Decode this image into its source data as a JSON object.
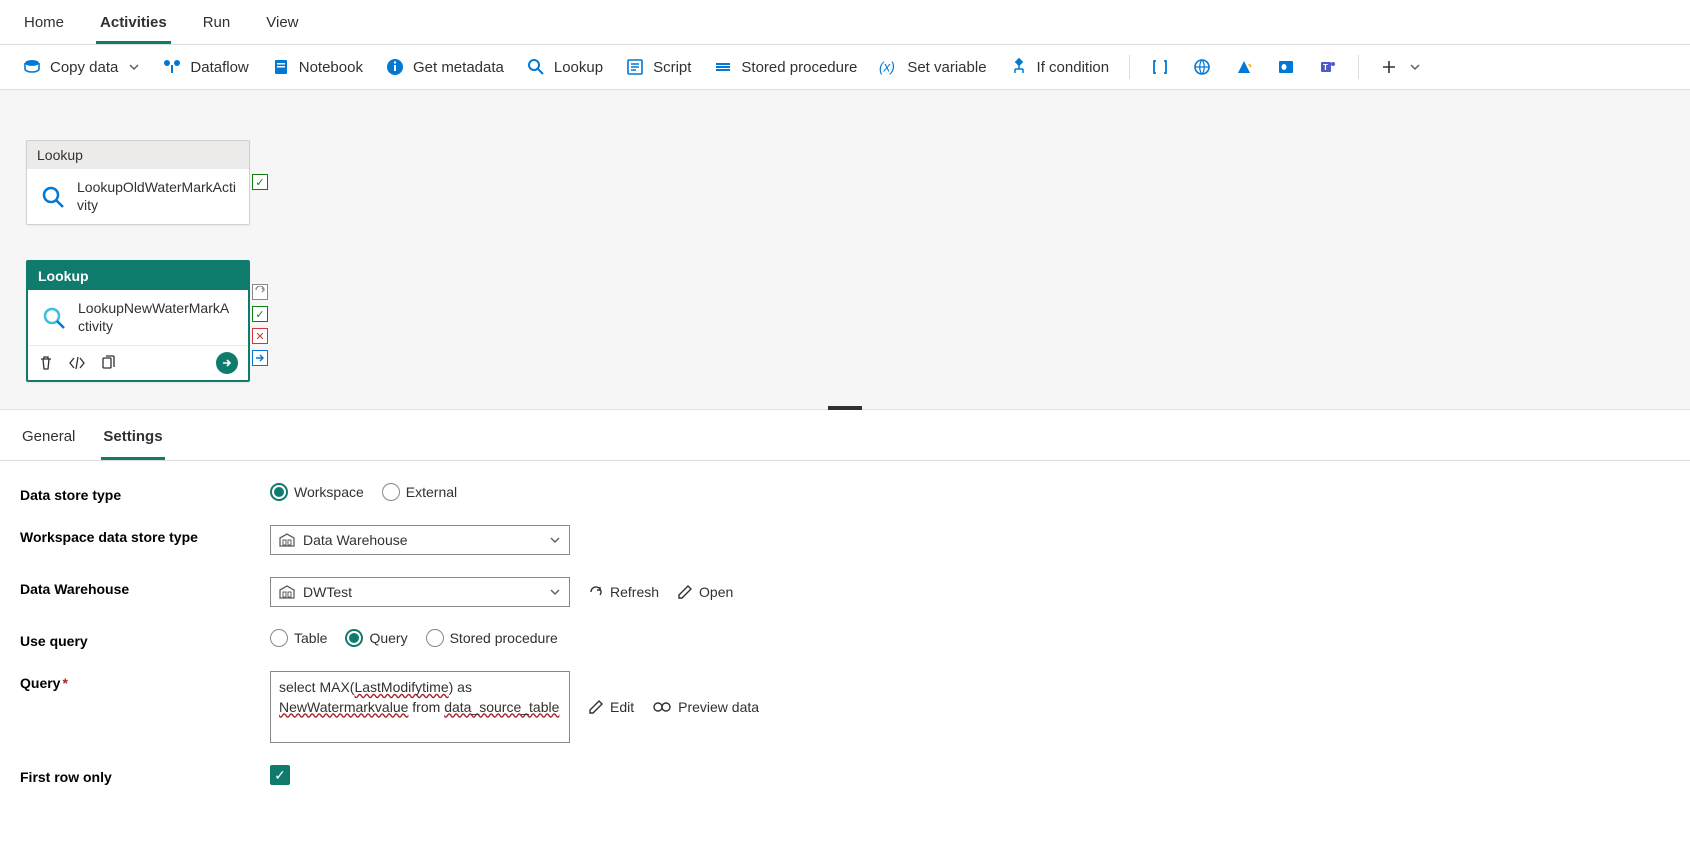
{
  "topTabs": {
    "home": "Home",
    "activities": "Activities",
    "run": "Run",
    "view": "View",
    "active": "activities"
  },
  "toolbar": {
    "copyData": "Copy data",
    "dataflow": "Dataflow",
    "notebook": "Notebook",
    "getMetadata": "Get metadata",
    "lookup": "Lookup",
    "script": "Script",
    "storedProcedure": "Stored procedure",
    "setVariable": "Set variable",
    "ifCondition": "If condition"
  },
  "canvas": {
    "card1": {
      "type": "Lookup",
      "name": "LookupOldWaterMarkActivity"
    },
    "card2": {
      "type": "Lookup",
      "name": "LookupNewWaterMarkActivity"
    }
  },
  "detailTabs": {
    "general": "General",
    "settings": "Settings",
    "active": "settings"
  },
  "settings": {
    "labels": {
      "dataStoreType": "Data store type",
      "wsDataStoreType": "Workspace data store type",
      "dataWarehouse": "Data Warehouse",
      "useQuery": "Use query",
      "query": "Query",
      "firstRowOnly": "First row only"
    },
    "dataStoreType": {
      "workspace": "Workspace",
      "external": "External",
      "selected": "workspace"
    },
    "wsDataStoreType": {
      "value": "Data Warehouse"
    },
    "dataWarehouse": {
      "value": "DWTest",
      "refresh": "Refresh",
      "open": "Open"
    },
    "useQuery": {
      "table": "Table",
      "query": "Query",
      "sp": "Stored procedure",
      "selected": "query"
    },
    "query": {
      "text": "select MAX(LastModifytime) as NewWatermarkvalue from data_source_table",
      "edit": "Edit",
      "preview": "Preview data"
    },
    "firstRowOnly": true
  }
}
